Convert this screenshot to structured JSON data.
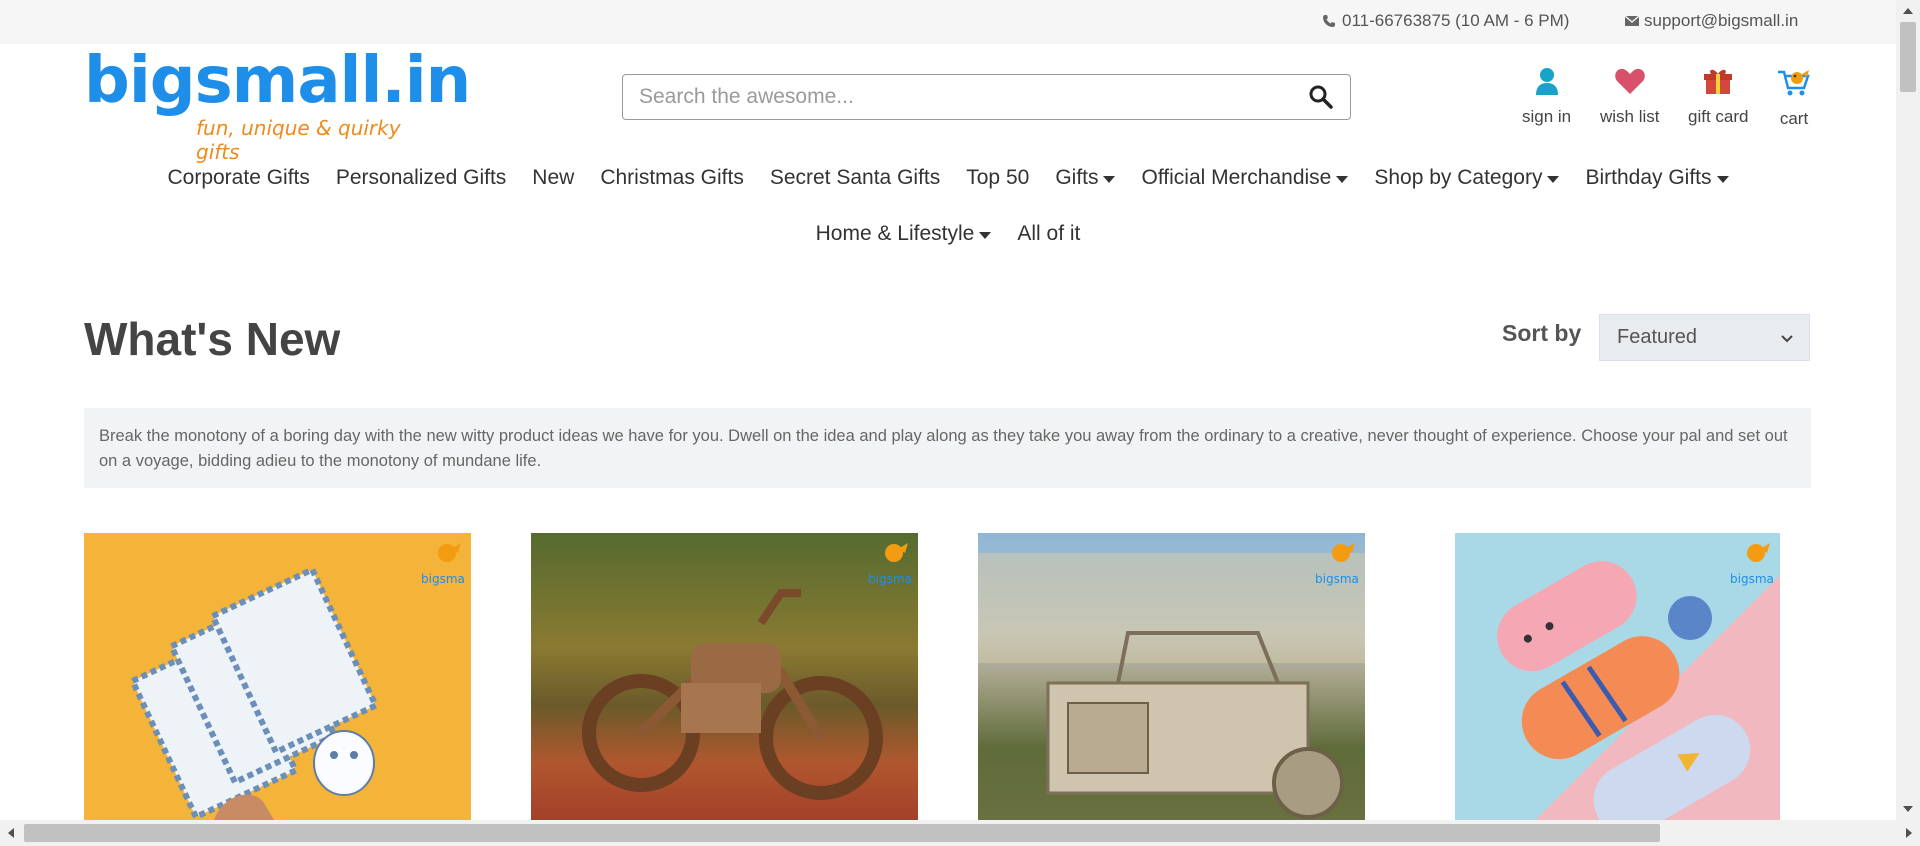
{
  "topbar": {
    "phone": "011-66763875 (10 AM - 6 PM)",
    "email": "support@bigsmall.in"
  },
  "logo": {
    "name": "bigsmall.in",
    "tagline": "fun, unique & quirky gifts"
  },
  "search": {
    "placeholder": "Search the awesome..."
  },
  "header_links": {
    "sign_in": "sign in",
    "wish_list": "wish list",
    "gift_card": "gift card",
    "cart": "cart"
  },
  "nav": {
    "row1": [
      {
        "label": "Corporate Gifts",
        "dropdown": false
      },
      {
        "label": "Personalized Gifts",
        "dropdown": false
      },
      {
        "label": "New",
        "dropdown": false
      },
      {
        "label": "Christmas Gifts",
        "dropdown": false
      },
      {
        "label": "Secret Santa Gifts",
        "dropdown": false
      },
      {
        "label": "Top 50",
        "dropdown": false
      },
      {
        "label": "Gifts",
        "dropdown": true
      },
      {
        "label": "Official Merchandise",
        "dropdown": true
      },
      {
        "label": "Shop by Category",
        "dropdown": true
      },
      {
        "label": "Birthday Gifts",
        "dropdown": true
      }
    ],
    "row2": [
      {
        "label": "Home & Lifestyle",
        "dropdown": true
      },
      {
        "label": "All of it",
        "dropdown": false
      }
    ]
  },
  "page": {
    "title": "What's New",
    "sort_label": "Sort by",
    "sort_value": "Featured",
    "description": "Break the monotony of a boring day with the new witty product ideas we have for you. Dwell on the idea and play along as they take you away from the ordinary to a creative, never thought of experience. Choose your pal and set out on a voyage, bidding adieu to the monotony of mundane life."
  },
  "products": [
    {
      "image": "owl-post-cards-image"
    },
    {
      "image": "wooden-motorcycle-model-image"
    },
    {
      "image": "wooden-vintage-car-model-image"
    },
    {
      "image": "animal-plush-pencil-cases-image"
    }
  ],
  "colors": {
    "brand_blue": "#1f8ee8",
    "brand_orange": "#f08a1c",
    "wish_heart": "#d9506a",
    "gift_red": "#c0392b",
    "signin_teal": "#1aa3c9"
  }
}
